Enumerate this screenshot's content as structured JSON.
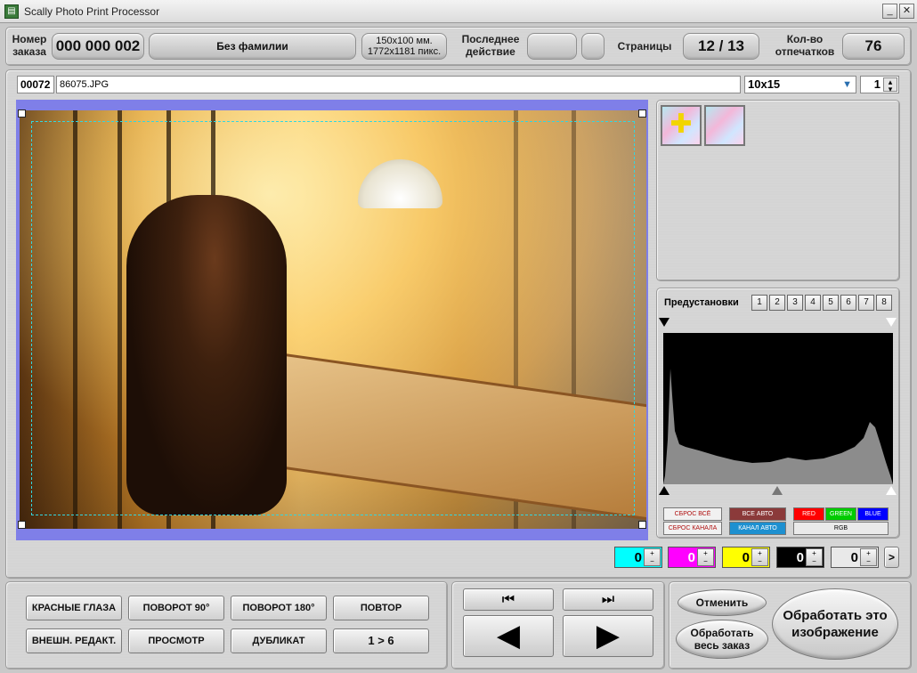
{
  "window": {
    "title": "Scally Photo Print Processor",
    "minimize": "_",
    "close": "✕"
  },
  "header": {
    "order_label": "Номер заказа",
    "order_number": "000 000 002",
    "customer": "Без фамилии",
    "format_line1": "150x100 мм.",
    "format_line2": "1772x1181 пикс.",
    "last_action_label": "Последнее действие",
    "last_action_value": "",
    "pages_label": "Страницы",
    "pages_value": "12 / 13",
    "copies_label": "Кол-во отпечатков",
    "copies_value": "76"
  },
  "file": {
    "index": "00072",
    "name": "86075.JPG",
    "size_select": "10x15",
    "count": "1"
  },
  "presets": {
    "label": "Предустановки",
    "buttons": [
      "1",
      "2",
      "3",
      "4",
      "5",
      "6",
      "7",
      "8"
    ]
  },
  "histogram": {
    "reset_all": "СБРОС ВСЁ",
    "reset_channel": "СБРОС КАНАЛА",
    "all_auto": "ВСЕ АВТО",
    "channel_auto": "КАНАЛ АВТО",
    "red": "RED",
    "green": "GREEN",
    "blue": "BLUE",
    "rgb": "RGB"
  },
  "color_adjust": {
    "cyan": "0",
    "magenta": "0",
    "yellow": "0",
    "black": "0",
    "density": "0",
    "next": ">"
  },
  "colors": {
    "cyan": "#00ffff",
    "magenta": "#ff00ff",
    "yellow": "#ffff00",
    "black": "#000000",
    "red_btn": "#ff0000",
    "green_btn": "#00cc00",
    "blue_btn": "#0000ff",
    "all_auto_btn": "#8b3a3a",
    "channel_auto_btn": "#1e90d0",
    "frame": "#7f7fe8"
  },
  "actions": {
    "red_eye": "КРАСНЫЕ ГЛАЗА",
    "rotate90": "ПОВОРОТ 90°",
    "rotate180": "ПОВОРОТ 180°",
    "repeat": "ПОВТОР",
    "ext_edit": "ВНЕШН. РЕДАКТ.",
    "preview": "ПРОСМОТР",
    "duplicate": "ДУБЛИКАТ",
    "one_to_six": "1 > 6"
  },
  "nav": {
    "first": "⏮",
    "last": "⏭",
    "prev": "◀",
    "next": "▶"
  },
  "process": {
    "cancel": "Отменить",
    "process_all": "Обработать весь заказ",
    "process_this": "Обработать это изображение"
  }
}
